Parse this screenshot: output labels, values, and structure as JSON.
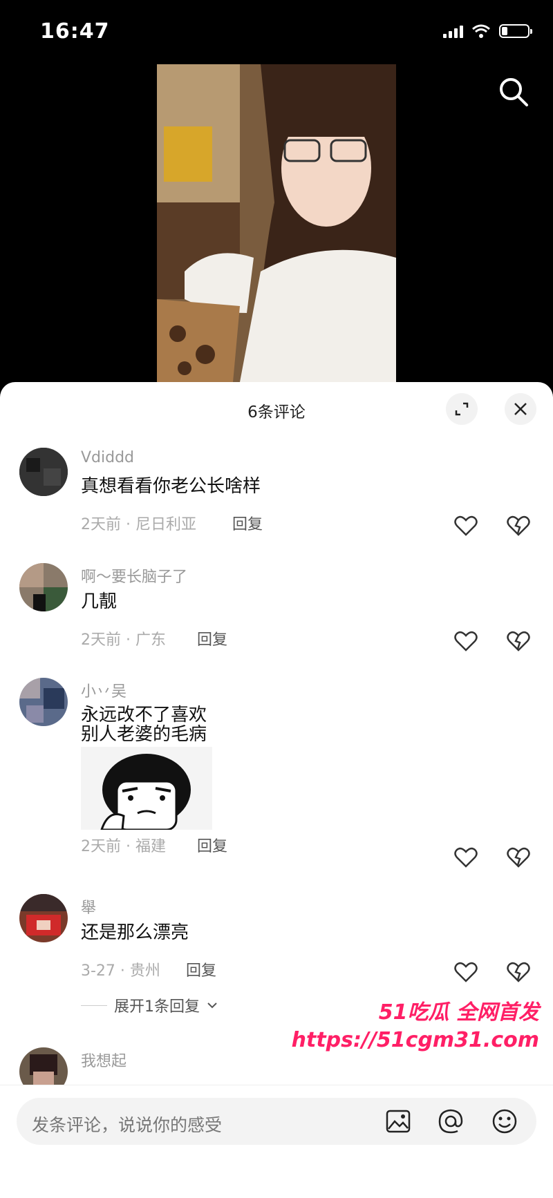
{
  "status_bar": {
    "time": "16:47"
  },
  "sheet": {
    "title": "6条评论"
  },
  "comments": [
    {
      "username": "Vdiddd",
      "text": "真想看看你老公长啥样",
      "meta": "2天前 · 尼日利亚",
      "reply_label": "回复"
    },
    {
      "username": "啊～要长脑子了",
      "text": "几靓",
      "meta": "2天前 · 广东",
      "reply_label": "回复"
    },
    {
      "username": "小丷吴",
      "text_line1": "永远改不了喜欢",
      "text_line2": "别人老婆的毛病",
      "meta": "2天前 · 福建",
      "reply_label": "回复"
    },
    {
      "username": "舉",
      "text": "还是那么漂亮",
      "meta": "3-27 · 贵州",
      "reply_label": "回复",
      "expand_label": "展开1条回复"
    },
    {
      "username": "我想起"
    }
  ],
  "watermark": {
    "line1": "51吃瓜 全网首发",
    "line2": "https://51cgm31.com"
  },
  "input": {
    "placeholder": "发条评论，说说你的感受"
  },
  "colors": {
    "accent": "#ff1f66",
    "sheet_bg": "#ffffff"
  }
}
